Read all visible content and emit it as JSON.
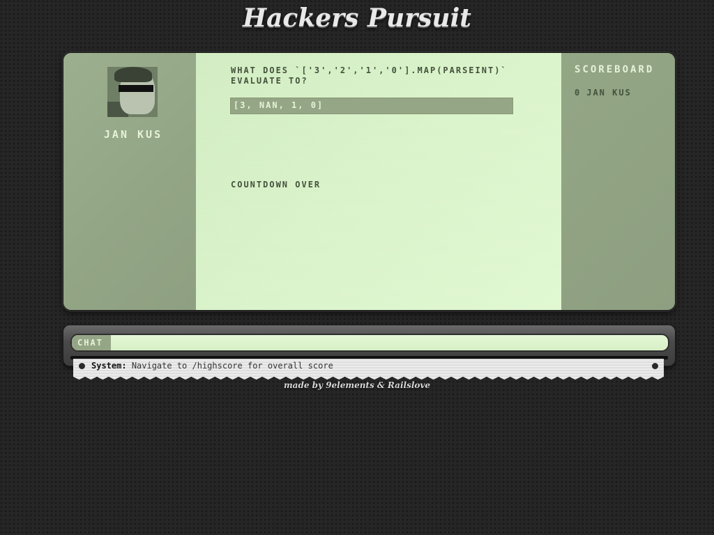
{
  "header": {
    "title": "Hackers Pursuit"
  },
  "player": {
    "name": "JAN KUS",
    "avatar_icon": "user-avatar-icon"
  },
  "question": {
    "text": "WHAT DOES `['3','2','1','0'].MAP(PARSEINT)` EVALUATE TO?",
    "answer": "[3, NAN, 1, 0]",
    "status": "COUNTDOWN OVER"
  },
  "scoreboard": {
    "title": "SCOREBOARD",
    "entries": [
      {
        "score": "0",
        "name": "JAN KUS"
      }
    ]
  },
  "chat": {
    "label": "CHAT",
    "input_value": "",
    "messages": [
      {
        "sender": "System:",
        "text": "Navigate to /highscore for overall score"
      }
    ]
  },
  "footer": {
    "credit": "made by 9elements & Railslove"
  },
  "colors": {
    "background": "#262626",
    "panel_green_light": "#daf3ca",
    "panel_green_dark": "#92a383",
    "text_dark_green": "#44523d",
    "text_light": "#e6f2d8"
  }
}
